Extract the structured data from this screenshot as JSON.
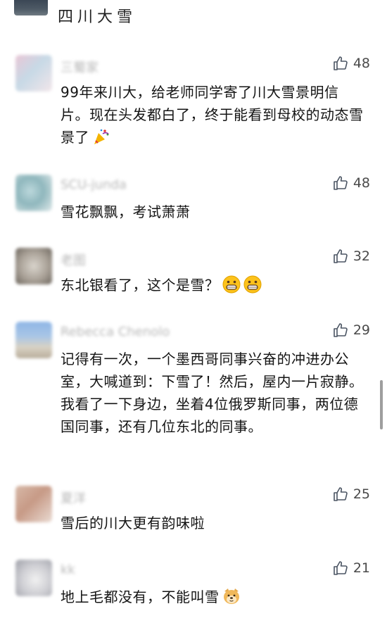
{
  "header": {
    "title": "四川大雪"
  },
  "comments": [
    {
      "name": "三蜀家",
      "likes": "48",
      "text": "99年来川大，给老师同学寄了川大雪景明信片。现在头发都白了，终于能看到母校的动态雪景了",
      "emoji": "party-popper-icon"
    },
    {
      "name": "SCU-junda",
      "likes": "48",
      "text": "雪花飘飘，考试萧萧"
    },
    {
      "name": "老图",
      "likes": "32",
      "text": "东北银看了，这个是雪？",
      "emoji": "grinning-face-icon"
    },
    {
      "name": "Rebecca Chenolo",
      "likes": "29",
      "text": "记得有一次，一个墨西哥同事兴奋的冲进办公室，大喊道到：下雪了！然后，屋内一片寂静。我看了一下身边，坐着4位俄罗斯同事，两位德国同事，还有几位东北的同事。"
    },
    {
      "name": "夏洋",
      "likes": "25",
      "text": "雪后的川大更有韵味啦"
    },
    {
      "name": "kk",
      "likes": "21",
      "text": "地上毛都没有，不能叫雪",
      "emoji": "doge-icon"
    }
  ],
  "colors": {
    "like_icon": "#4b5563",
    "name_text": "#b7b7b7",
    "body_text": "#141414"
  }
}
